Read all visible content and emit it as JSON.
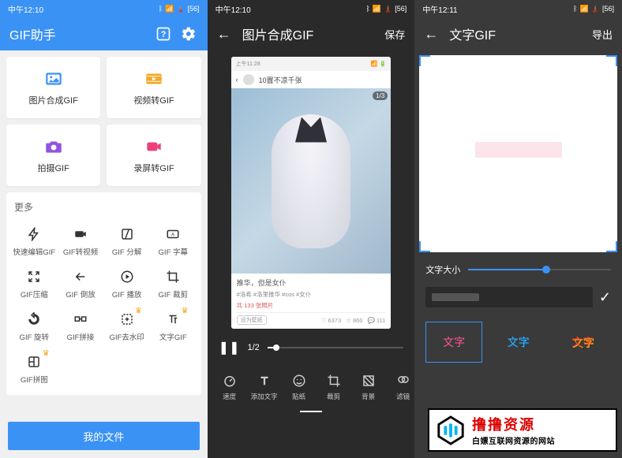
{
  "screen1": {
    "status_time": "中午12:10",
    "title": "GIF助手",
    "cards": [
      {
        "label": "图片合成GIF",
        "color": "#3b92f5"
      },
      {
        "label": "视频转GIF",
        "color": "#f5a623"
      },
      {
        "label": "拍摄GIF",
        "color": "#9055e0"
      },
      {
        "label": "录屏转GIF",
        "color": "#ec407a"
      }
    ],
    "more_title": "更多",
    "tools": [
      {
        "label": "快速编辑GIF"
      },
      {
        "label": "GIF转视频"
      },
      {
        "label": "GIF 分解"
      },
      {
        "label": "GIF 字幕"
      },
      {
        "label": "GIF压缩"
      },
      {
        "label": "GIF 倒放"
      },
      {
        "label": "GIF 播放"
      },
      {
        "label": "GIF 裁剪"
      },
      {
        "label": "GIF 旋转"
      },
      {
        "label": "GIF拼接"
      },
      {
        "label": "GIF去水印",
        "crown": true
      },
      {
        "label": "文字GIF",
        "crown": true
      },
      {
        "label": "GIF拼图",
        "crown": true
      }
    ],
    "bottom_button": "我的文件"
  },
  "screen2": {
    "status_time": "中午12:10",
    "title": "图片合成GIF",
    "action": "保存",
    "preview": {
      "inner_status_time": "上午11:28",
      "header_text": "10置不凉千张",
      "badge": "1/3",
      "meta_title": "推华，但是女仆",
      "meta_tags": "#洛希 #洛里推华 #cos #女仆",
      "meta_red": "共 133 张照片",
      "btn_text": "设为壁纸",
      "stat1": "6373",
      "stat2": "866",
      "stat3": "111"
    },
    "frame_text": "1/2",
    "tools": [
      {
        "label": "速度"
      },
      {
        "label": "添加文字"
      },
      {
        "label": "贴纸"
      },
      {
        "label": "裁剪"
      },
      {
        "label": "背景"
      },
      {
        "label": "滤镜"
      }
    ]
  },
  "screen3": {
    "status_time": "中午12:11",
    "title": "文字GIF",
    "action": "导出",
    "slider_label": "文字大小",
    "input_placeholder": "",
    "styles": [
      {
        "text": "文字",
        "active": true
      },
      {
        "text": "文字"
      },
      {
        "text": "文字"
      }
    ]
  },
  "watermark": {
    "main": "撸撸资源",
    "sub": "白嫖互联网资源的网站"
  }
}
